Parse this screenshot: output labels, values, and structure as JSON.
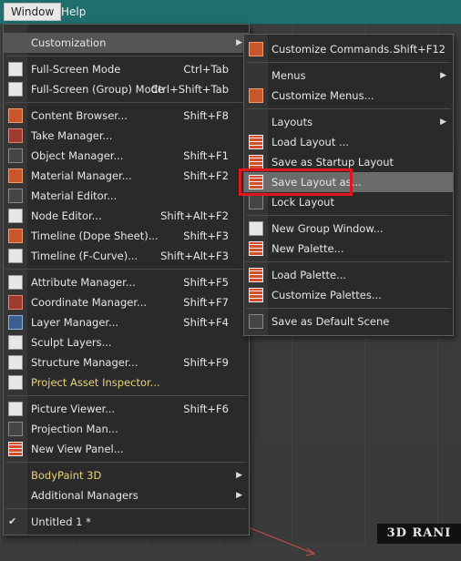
{
  "menubar": {
    "window": "Window",
    "help": "Help"
  },
  "main_menu": [
    {
      "label": "Customization",
      "shortcut": "",
      "submenu": true,
      "highlight": true
    },
    {
      "sep": true
    },
    {
      "label": "Full-Screen Mode",
      "shortcut": "Ctrl+Tab",
      "icon": "fullscreen-icon"
    },
    {
      "label": "Full-Screen (Group) Mode",
      "shortcut": "Ctrl+Shift+Tab",
      "icon": "fullscreen-group-icon"
    },
    {
      "sep": true
    },
    {
      "label": "Content Browser...",
      "shortcut": "Shift+F8",
      "icon": "content-browser-icon"
    },
    {
      "label": "Take Manager...",
      "shortcut": "",
      "icon": "take-manager-icon"
    },
    {
      "label": "Object Manager...",
      "shortcut": "Shift+F1",
      "icon": "object-manager-icon"
    },
    {
      "label": "Material Manager...",
      "shortcut": "Shift+F2",
      "icon": "material-manager-icon"
    },
    {
      "label": "Material Editor...",
      "shortcut": "",
      "icon": "material-editor-icon"
    },
    {
      "label": "Node Editor...",
      "shortcut": "Shift+Alt+F2",
      "icon": "node-editor-icon"
    },
    {
      "label": "Timeline (Dope Sheet)...",
      "shortcut": "Shift+F3",
      "icon": "timeline-dope-icon"
    },
    {
      "label": "Timeline (F-Curve)...",
      "shortcut": "Shift+Alt+F3",
      "icon": "timeline-fcurve-icon"
    },
    {
      "sep": true
    },
    {
      "label": "Attribute Manager...",
      "shortcut": "Shift+F5",
      "icon": "attribute-manager-icon"
    },
    {
      "label": "Coordinate Manager...",
      "shortcut": "Shift+F7",
      "icon": "coordinate-manager-icon"
    },
    {
      "label": "Layer Manager...",
      "shortcut": "Shift+F4",
      "icon": "layer-manager-icon"
    },
    {
      "label": "Sculpt Layers...",
      "shortcut": "",
      "icon": "sculpt-layers-icon"
    },
    {
      "label": "Structure Manager...",
      "shortcut": "Shift+F9",
      "icon": "structure-manager-icon"
    },
    {
      "label": "Project Asset Inspector...",
      "shortcut": "",
      "icon": "asset-inspector-icon",
      "gold": true
    },
    {
      "sep": true
    },
    {
      "label": "Picture Viewer...",
      "shortcut": "Shift+F6",
      "icon": "picture-viewer-icon"
    },
    {
      "label": "Projection Man...",
      "shortcut": "",
      "icon": "projection-man-icon"
    },
    {
      "label": "New View Panel...",
      "shortcut": "",
      "icon": "new-view-panel-icon"
    },
    {
      "sep": true
    },
    {
      "label": "BodyPaint 3D",
      "shortcut": "",
      "submenu": true,
      "gold": true
    },
    {
      "label": "Additional Managers",
      "shortcut": "",
      "submenu": true
    },
    {
      "sep": true
    },
    {
      "label": "Untitled 1 *",
      "shortcut": "",
      "icon": "checkmark-icon"
    }
  ],
  "sub_menu": [
    {
      "label": "Customize Commands...",
      "shortcut": "Shift+F12",
      "icon": "customize-commands-icon"
    },
    {
      "sep": true
    },
    {
      "label": "Menus",
      "submenu": true
    },
    {
      "label": "Customize Menus...",
      "icon": "customize-menus-icon"
    },
    {
      "sep": true
    },
    {
      "label": "Layouts",
      "submenu": true
    },
    {
      "label": "Load Layout ...",
      "icon": "load-layout-icon"
    },
    {
      "label": "Save as Startup Layout",
      "icon": "save-startup-layout-icon"
    },
    {
      "label": "Save Layout as...",
      "icon": "save-layout-icon",
      "highlight": true
    },
    {
      "label": "Lock Layout",
      "icon": "lock-layout-icon"
    },
    {
      "sep": true
    },
    {
      "label": "New Group Window...",
      "icon": "new-group-window-icon"
    },
    {
      "label": "New Palette...",
      "icon": "new-palette-icon"
    },
    {
      "sep": true
    },
    {
      "label": "Load Palette...",
      "icon": "load-palette-icon"
    },
    {
      "label": "Customize Palettes...",
      "icon": "customize-palettes-icon"
    },
    {
      "sep": true
    },
    {
      "label": "Save as Default Scene",
      "icon": "save-default-scene-icon"
    }
  ],
  "watermark": "3D RANI",
  "colors": {
    "menubar": "#1f6f6e",
    "menu_bg": "#2a2a2a",
    "highlight_box": "#e0161c"
  }
}
